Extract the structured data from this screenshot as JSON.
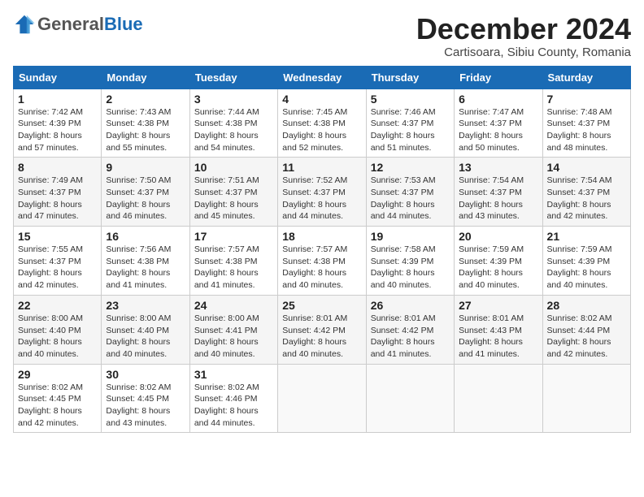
{
  "logo": {
    "general": "General",
    "blue": "Blue"
  },
  "title": "December 2024",
  "subtitle": "Cartisoara, Sibiu County, Romania",
  "days_of_week": [
    "Sunday",
    "Monday",
    "Tuesday",
    "Wednesday",
    "Thursday",
    "Friday",
    "Saturday"
  ],
  "weeks": [
    [
      {
        "day": "1",
        "sunrise": "Sunrise: 7:42 AM",
        "sunset": "Sunset: 4:39 PM",
        "daylight": "Daylight: 8 hours and 57 minutes."
      },
      {
        "day": "2",
        "sunrise": "Sunrise: 7:43 AM",
        "sunset": "Sunset: 4:38 PM",
        "daylight": "Daylight: 8 hours and 55 minutes."
      },
      {
        "day": "3",
        "sunrise": "Sunrise: 7:44 AM",
        "sunset": "Sunset: 4:38 PM",
        "daylight": "Daylight: 8 hours and 54 minutes."
      },
      {
        "day": "4",
        "sunrise": "Sunrise: 7:45 AM",
        "sunset": "Sunset: 4:38 PM",
        "daylight": "Daylight: 8 hours and 52 minutes."
      },
      {
        "day": "5",
        "sunrise": "Sunrise: 7:46 AM",
        "sunset": "Sunset: 4:37 PM",
        "daylight": "Daylight: 8 hours and 51 minutes."
      },
      {
        "day": "6",
        "sunrise": "Sunrise: 7:47 AM",
        "sunset": "Sunset: 4:37 PM",
        "daylight": "Daylight: 8 hours and 50 minutes."
      },
      {
        "day": "7",
        "sunrise": "Sunrise: 7:48 AM",
        "sunset": "Sunset: 4:37 PM",
        "daylight": "Daylight: 8 hours and 48 minutes."
      }
    ],
    [
      {
        "day": "8",
        "sunrise": "Sunrise: 7:49 AM",
        "sunset": "Sunset: 4:37 PM",
        "daylight": "Daylight: 8 hours and 47 minutes."
      },
      {
        "day": "9",
        "sunrise": "Sunrise: 7:50 AM",
        "sunset": "Sunset: 4:37 PM",
        "daylight": "Daylight: 8 hours and 46 minutes."
      },
      {
        "day": "10",
        "sunrise": "Sunrise: 7:51 AM",
        "sunset": "Sunset: 4:37 PM",
        "daylight": "Daylight: 8 hours and 45 minutes."
      },
      {
        "day": "11",
        "sunrise": "Sunrise: 7:52 AM",
        "sunset": "Sunset: 4:37 PM",
        "daylight": "Daylight: 8 hours and 44 minutes."
      },
      {
        "day": "12",
        "sunrise": "Sunrise: 7:53 AM",
        "sunset": "Sunset: 4:37 PM",
        "daylight": "Daylight: 8 hours and 44 minutes."
      },
      {
        "day": "13",
        "sunrise": "Sunrise: 7:54 AM",
        "sunset": "Sunset: 4:37 PM",
        "daylight": "Daylight: 8 hours and 43 minutes."
      },
      {
        "day": "14",
        "sunrise": "Sunrise: 7:54 AM",
        "sunset": "Sunset: 4:37 PM",
        "daylight": "Daylight: 8 hours and 42 minutes."
      }
    ],
    [
      {
        "day": "15",
        "sunrise": "Sunrise: 7:55 AM",
        "sunset": "Sunset: 4:37 PM",
        "daylight": "Daylight: 8 hours and 42 minutes."
      },
      {
        "day": "16",
        "sunrise": "Sunrise: 7:56 AM",
        "sunset": "Sunset: 4:38 PM",
        "daylight": "Daylight: 8 hours and 41 minutes."
      },
      {
        "day": "17",
        "sunrise": "Sunrise: 7:57 AM",
        "sunset": "Sunset: 4:38 PM",
        "daylight": "Daylight: 8 hours and 41 minutes."
      },
      {
        "day": "18",
        "sunrise": "Sunrise: 7:57 AM",
        "sunset": "Sunset: 4:38 PM",
        "daylight": "Daylight: 8 hours and 40 minutes."
      },
      {
        "day": "19",
        "sunrise": "Sunrise: 7:58 AM",
        "sunset": "Sunset: 4:39 PM",
        "daylight": "Daylight: 8 hours and 40 minutes."
      },
      {
        "day": "20",
        "sunrise": "Sunrise: 7:59 AM",
        "sunset": "Sunset: 4:39 PM",
        "daylight": "Daylight: 8 hours and 40 minutes."
      },
      {
        "day": "21",
        "sunrise": "Sunrise: 7:59 AM",
        "sunset": "Sunset: 4:39 PM",
        "daylight": "Daylight: 8 hours and 40 minutes."
      }
    ],
    [
      {
        "day": "22",
        "sunrise": "Sunrise: 8:00 AM",
        "sunset": "Sunset: 4:40 PM",
        "daylight": "Daylight: 8 hours and 40 minutes."
      },
      {
        "day": "23",
        "sunrise": "Sunrise: 8:00 AM",
        "sunset": "Sunset: 4:40 PM",
        "daylight": "Daylight: 8 hours and 40 minutes."
      },
      {
        "day": "24",
        "sunrise": "Sunrise: 8:00 AM",
        "sunset": "Sunset: 4:41 PM",
        "daylight": "Daylight: 8 hours and 40 minutes."
      },
      {
        "day": "25",
        "sunrise": "Sunrise: 8:01 AM",
        "sunset": "Sunset: 4:42 PM",
        "daylight": "Daylight: 8 hours and 40 minutes."
      },
      {
        "day": "26",
        "sunrise": "Sunrise: 8:01 AM",
        "sunset": "Sunset: 4:42 PM",
        "daylight": "Daylight: 8 hours and 41 minutes."
      },
      {
        "day": "27",
        "sunrise": "Sunrise: 8:01 AM",
        "sunset": "Sunset: 4:43 PM",
        "daylight": "Daylight: 8 hours and 41 minutes."
      },
      {
        "day": "28",
        "sunrise": "Sunrise: 8:02 AM",
        "sunset": "Sunset: 4:44 PM",
        "daylight": "Daylight: 8 hours and 42 minutes."
      }
    ],
    [
      {
        "day": "29",
        "sunrise": "Sunrise: 8:02 AM",
        "sunset": "Sunset: 4:45 PM",
        "daylight": "Daylight: 8 hours and 42 minutes."
      },
      {
        "day": "30",
        "sunrise": "Sunrise: 8:02 AM",
        "sunset": "Sunset: 4:45 PM",
        "daylight": "Daylight: 8 hours and 43 minutes."
      },
      {
        "day": "31",
        "sunrise": "Sunrise: 8:02 AM",
        "sunset": "Sunset: 4:46 PM",
        "daylight": "Daylight: 8 hours and 44 minutes."
      },
      null,
      null,
      null,
      null
    ]
  ]
}
